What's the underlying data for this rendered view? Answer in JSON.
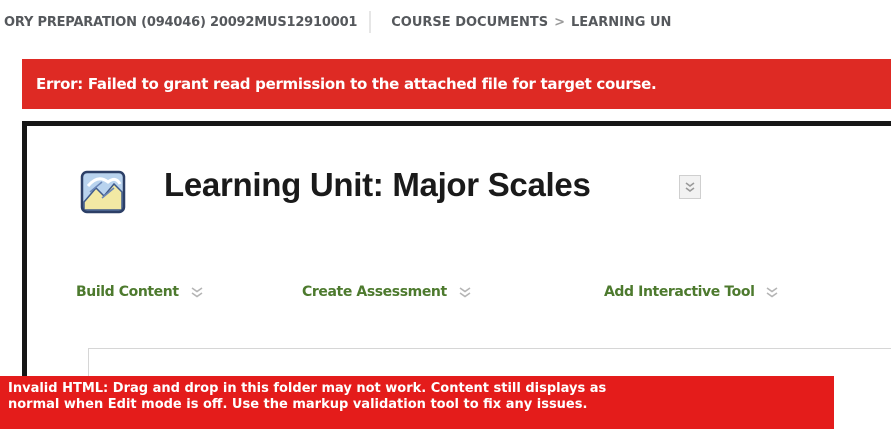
{
  "breadcrumb": {
    "course": "ORY PREPARATION (094046) 20092MUS12910001",
    "section": "COURSE DOCUMENTS",
    "separator": ">",
    "current": "LEARNING UN"
  },
  "error": {
    "message": "Error: Failed to grant read permission to the attached file for target course."
  },
  "page": {
    "title": "Learning Unit: Major Scales",
    "icon": "learning-unit-icon"
  },
  "actions": [
    {
      "label": "Build Content"
    },
    {
      "label": "Create Assessment"
    },
    {
      "label": "Add Interactive Tool"
    }
  ],
  "warning": {
    "line1": "Invalid HTML: Drag and drop in this folder may not work. Content still displays as",
    "line2": "normal when Edit mode is off. Use the markup validation tool to fix any issues."
  },
  "colors": {
    "error_bg": "#de2a24",
    "warning_bg": "#e41c1b",
    "action_text": "#4d7a2e"
  }
}
